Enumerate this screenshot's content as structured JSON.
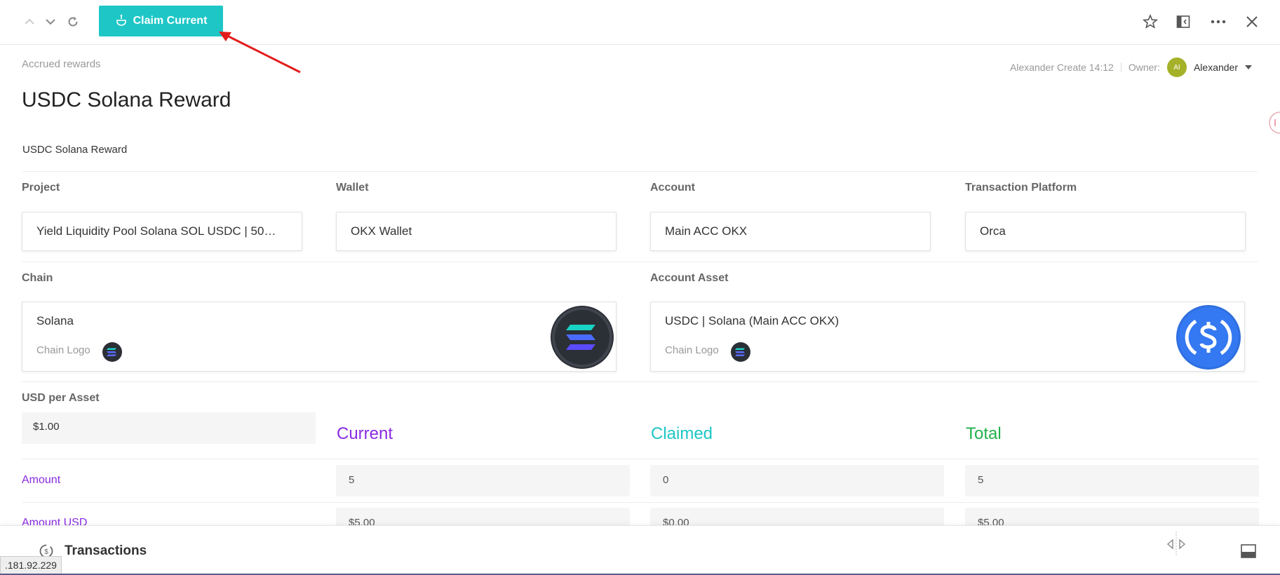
{
  "toolbar": {
    "claim_label": "Claim Current"
  },
  "header": {
    "breadcrumb": "Accrued rewards",
    "created_text": "Alexander Create 14:12",
    "owner_label": "Owner:",
    "owner_initials": "AI",
    "owner_name": "Alexander",
    "title": "USDC Solana Reward",
    "subtitle": "USDC Solana Reward"
  },
  "fields": {
    "project_label": "Project",
    "project_value": "Yield Liquidity Pool Solana SOL USDC | 50…",
    "wallet_label": "Wallet",
    "wallet_value": "OKX Wallet",
    "account_label": "Account",
    "account_value": "Main ACC OKX",
    "platform_label": "Transaction Platform",
    "platform_value": "Orca",
    "chain_label": "Chain",
    "chain_value": "Solana",
    "chain_logo_label": "Chain Logo",
    "asset_label": "Account Asset",
    "asset_value": "USDC | Solana (Main ACC OKX)",
    "asset_logo_label": "Chain Logo",
    "usd_per_asset_label": "USD per Asset",
    "usd_per_asset_value": "$1.00"
  },
  "columns": {
    "current": "Current",
    "claimed": "Claimed",
    "total": "Total"
  },
  "rows": [
    {
      "label": "Amount",
      "current": "5",
      "claimed": "0",
      "total": "5"
    },
    {
      "label": "Amount USD",
      "current": "$5.00",
      "claimed": "$0.00",
      "total": "$5.00"
    }
  ],
  "bottom": {
    "title": "Transactions",
    "ip": ".181.92.229"
  },
  "colors": {
    "accent": "#1ec6c6",
    "current": "#8a2be2",
    "claimed": "#1ec6c6",
    "total": "#22b14c",
    "usdc_blue": "#2775ca"
  }
}
